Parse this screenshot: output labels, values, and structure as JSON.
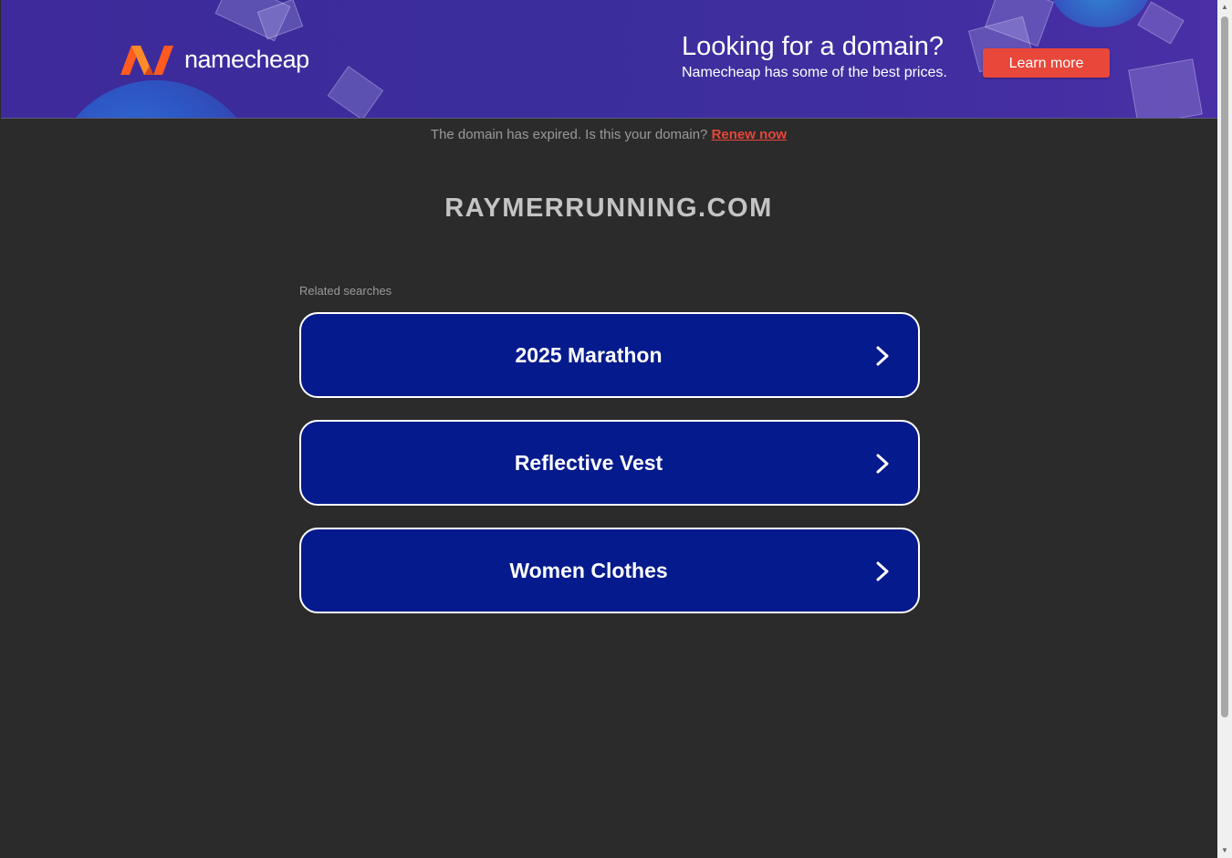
{
  "banner": {
    "logo_text": "namecheap",
    "promo_title": "Looking for a domain?",
    "promo_subtitle": "Namecheap has some of the best prices.",
    "learn_more_label": "Learn more",
    "colors": {
      "accent": "#e8473a",
      "background": "#3e2a9a",
      "logo_orange": "#ff6a1a"
    }
  },
  "notice": {
    "text": "The domain has expired. Is this your domain?",
    "link_label": "Renew now"
  },
  "domain": "RAYMERRUNNING.COM",
  "related": {
    "label": "Related searches",
    "items": [
      {
        "label": "2025 Marathon"
      },
      {
        "label": "Reflective Vest"
      },
      {
        "label": "Women Clothes"
      }
    ],
    "item_color": "#051a8c"
  },
  "icons": {
    "chevron": "chevron-right-icon",
    "logo": "namecheap-logo-icon"
  }
}
